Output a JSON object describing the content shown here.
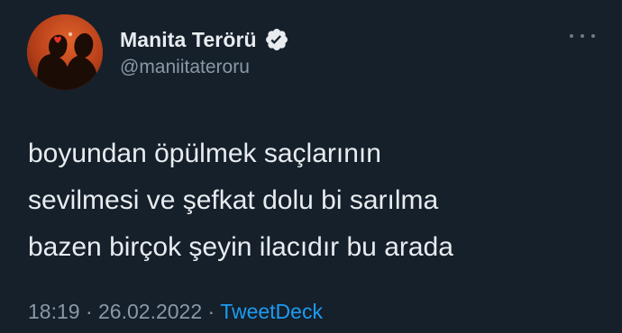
{
  "author": {
    "display_name": "Manita Terörü",
    "handle": "@maniitateroru",
    "verified": true,
    "avatar_icon": "profile-avatar"
  },
  "tweet": {
    "lines": [
      "boyundan öpülmek saçlarının",
      "sevilmesi ve şefkat dolu bi sarılma",
      "bazen birçok şeyin ilacıdır bu arada"
    ]
  },
  "meta": {
    "time": "18:19",
    "separator": "·",
    "date": "26.02.2022",
    "source": "TweetDeck"
  },
  "colors": {
    "background": "#15202b",
    "primary_text": "#e8ecef",
    "secondary_text": "#8b98a5",
    "accent": "#1d9bf0"
  },
  "icons": {
    "verified": "verified-badge-icon",
    "more": "more-options-icon"
  }
}
